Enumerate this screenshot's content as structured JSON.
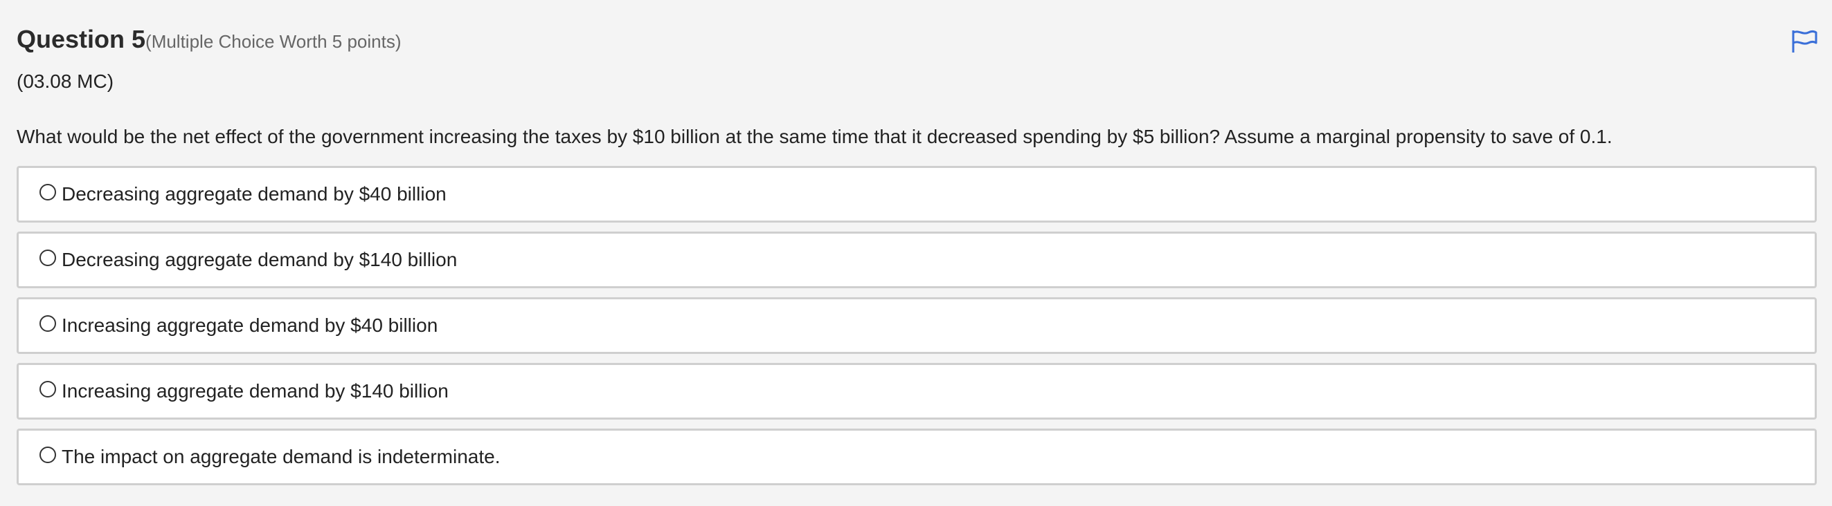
{
  "question": {
    "title": "Question 5",
    "worth": "(Multiple Choice Worth 5 points)",
    "code": "(03.08 MC)",
    "prompt": "What would be the net effect of the government increasing the taxes by $10 billion at the same time that it decreased spending by $5 billion? Assume a marginal propensity to save of 0.1.",
    "options": [
      {
        "label": "Decreasing aggregate demand by $40 billion",
        "selected": false
      },
      {
        "label": "Decreasing aggregate demand by $140 billion",
        "selected": false
      },
      {
        "label": "Increasing aggregate demand by $40 billion",
        "selected": false
      },
      {
        "label": "Increasing aggregate demand by $140 billion",
        "selected": false
      },
      {
        "label": "The impact on aggregate demand is indeterminate.",
        "selected": false
      }
    ]
  },
  "icons": {
    "flag": "flag-icon"
  },
  "colors": {
    "background": "#f4f4f4",
    "flag": "#3a6fd8",
    "option_border": "#cfcfcf",
    "worth_text": "#666666"
  }
}
